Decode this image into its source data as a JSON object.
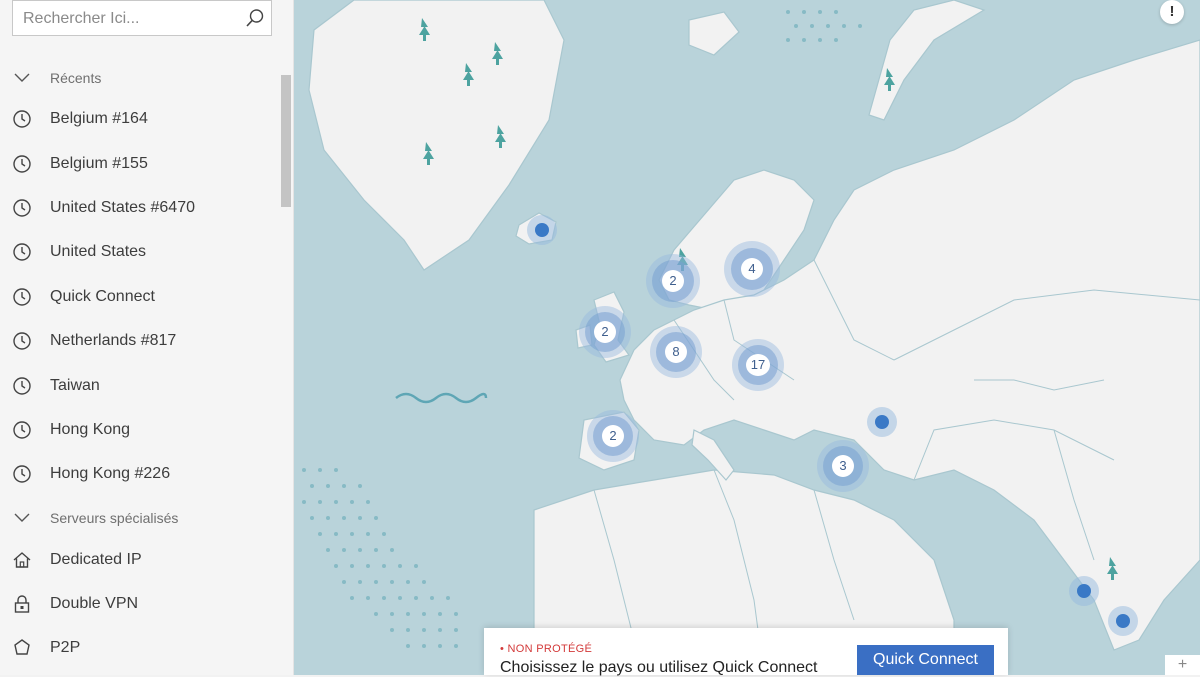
{
  "search": {
    "placeholder": "Rechercher Ici..."
  },
  "sidebar": {
    "recents_header": "Récents",
    "recents": [
      {
        "label": "Belgium #164",
        "icon": "clock-icon"
      },
      {
        "label": "Belgium #155",
        "icon": "clock-icon"
      },
      {
        "label": "United States #6470",
        "icon": "clock-icon"
      },
      {
        "label": "United States",
        "icon": "clock-icon"
      },
      {
        "label": "Quick Connect",
        "icon": "clock-icon"
      },
      {
        "label": "Netherlands #817",
        "icon": "clock-icon"
      },
      {
        "label": "Taiwan",
        "icon": "clock-icon"
      },
      {
        "label": "Hong Kong",
        "icon": "clock-icon"
      },
      {
        "label": "Hong Kong #226",
        "icon": "clock-icon"
      }
    ],
    "specialty_header": "Serveurs spécialisés",
    "specialty": [
      {
        "label": "Dedicated IP",
        "icon": "home-icon"
      },
      {
        "label": "Double VPN",
        "icon": "lock-icon"
      },
      {
        "label": "P2P",
        "icon": "p2p-icon"
      }
    ]
  },
  "map": {
    "clusters": [
      {
        "id": "uk",
        "count": "2"
      },
      {
        "id": "norway",
        "count": "2"
      },
      {
        "id": "sweden",
        "count": "4"
      },
      {
        "id": "germany",
        "count": "8"
      },
      {
        "id": "central-europe",
        "count": "17"
      },
      {
        "id": "iberia",
        "count": "2"
      },
      {
        "id": "middle-east",
        "count": "3"
      }
    ],
    "colors": {
      "sea": "#b9d3da",
      "land": "#f2f2f2",
      "marker": "#3a79c6",
      "tree": "#4da3a0"
    }
  },
  "status": {
    "badge": "NON PROTÉGÉ",
    "message": "Choisissez le pays ou utilisez Quick Connect",
    "quick_connect_label": "Quick Connect",
    "status_color": "#d33a3a"
  },
  "info_button": {
    "label": "!"
  },
  "zoom_button": {
    "label": "+"
  }
}
